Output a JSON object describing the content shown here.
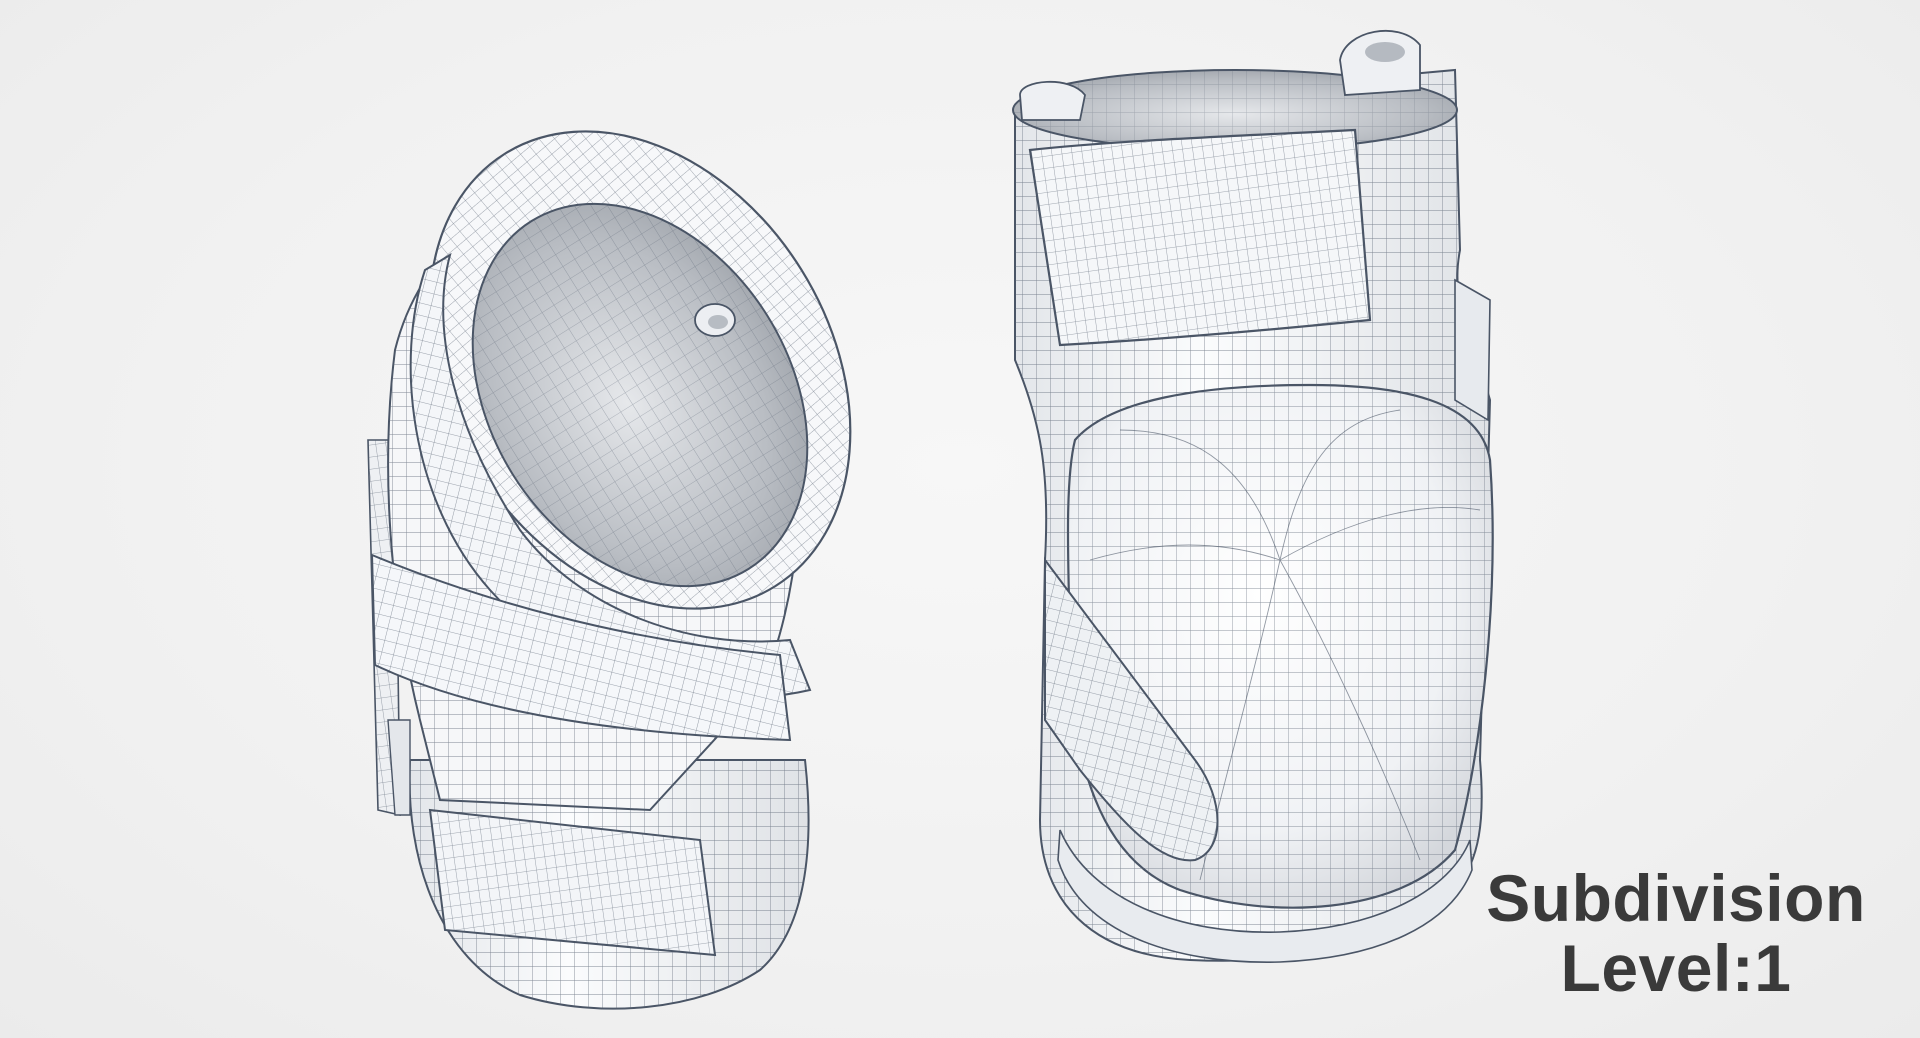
{
  "caption": {
    "line1": "Subdivision",
    "line2": "Level:1"
  },
  "colors": {
    "background": "#f2f2f2",
    "mesh_surface": "#f7f9fc",
    "mesh_shadow": "#c9ccd1",
    "wire": "#4a5566",
    "caption_text": "#3a3a3a"
  }
}
